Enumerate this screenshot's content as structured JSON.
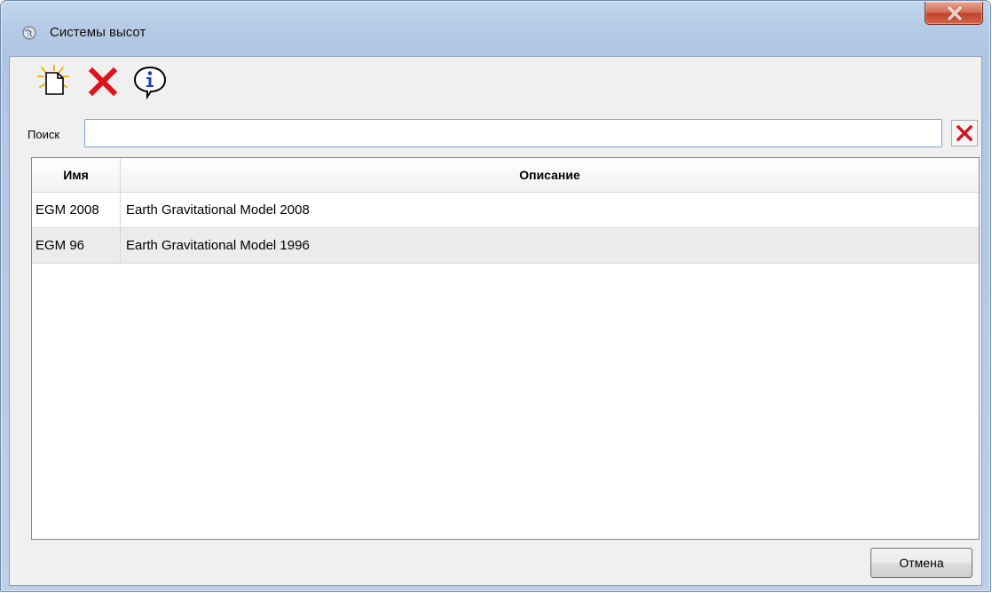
{
  "window": {
    "title": "Системы высот",
    "icon": "globe-icon",
    "close_icon": "close-icon"
  },
  "toolbar": {
    "buttons": [
      {
        "name": "new-document-icon"
      },
      {
        "name": "delete-icon"
      },
      {
        "name": "info-icon"
      }
    ]
  },
  "search": {
    "label": "Поиск",
    "value": "",
    "clear_icon": "clear-x-icon"
  },
  "table": {
    "columns": [
      "Имя",
      "Описание"
    ],
    "rows": [
      {
        "name": "EGM 2008",
        "description": "Earth Gravitational Model 2008"
      },
      {
        "name": "EGM 96",
        "description": "Earth Gravitational Model 1996"
      }
    ]
  },
  "footer": {
    "cancel_label": "Отмена"
  },
  "colors": {
    "close_button": "#c2442a",
    "delete_red": "#e0131b",
    "info_blue": "#1f3fbf",
    "new_doc_accent": "#f2b31b"
  }
}
